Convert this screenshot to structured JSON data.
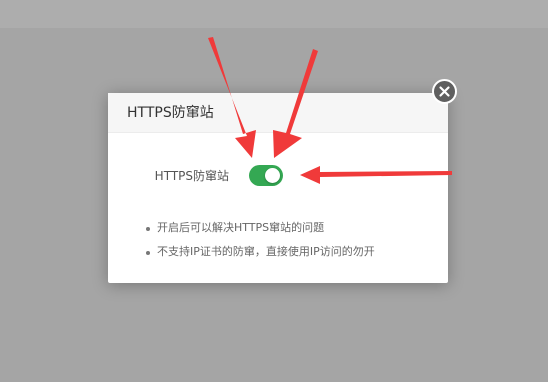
{
  "dialog": {
    "title": "HTTPS防窜站",
    "close_icon": "close-icon"
  },
  "setting": {
    "label": "HTTPS防窜站",
    "enabled": true,
    "toggle_color": "#34a853"
  },
  "tips": [
    "开启后可以解决HTTPS窜站的问题",
    "不支持IP证书的防窜，直接使用IP访问的勿开"
  ],
  "annotation": {
    "arrow_color": "#f03a3a"
  }
}
